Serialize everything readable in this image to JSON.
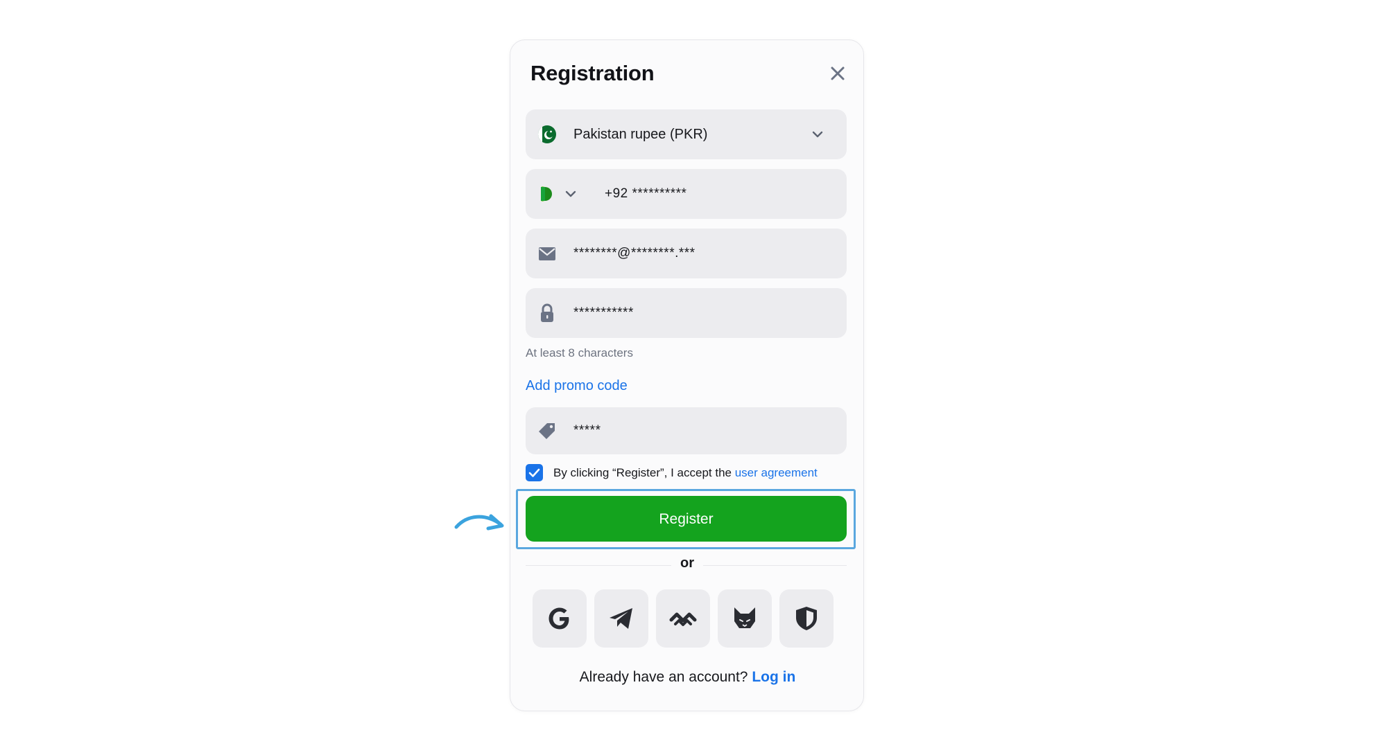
{
  "modal": {
    "title": "Registration",
    "currency": {
      "value": "Pakistan rupee (PKR)"
    },
    "phone": {
      "value": "+92 **********"
    },
    "email": {
      "value": "********@********.***"
    },
    "password": {
      "value": "***********",
      "hint": "At least 8 characters"
    },
    "promo": {
      "link_label": "Add promo code",
      "value": "*****"
    },
    "agreement": {
      "checked": true,
      "text": "By clicking “Register”, I accept the",
      "link_label": "user agreement"
    },
    "register_label": "Register",
    "or_label": "or",
    "social_buttons": [
      "google-icon",
      "telegram-icon",
      "waves-icon",
      "fox-icon",
      "shield-icon"
    ],
    "footer": {
      "text": "Already have an account?",
      "link_label": "Log in"
    }
  },
  "colors": {
    "accent_blue": "#1a73e8",
    "register_green": "#14a31e",
    "field_bg": "#ececef",
    "highlight_border": "#5aa7df"
  }
}
